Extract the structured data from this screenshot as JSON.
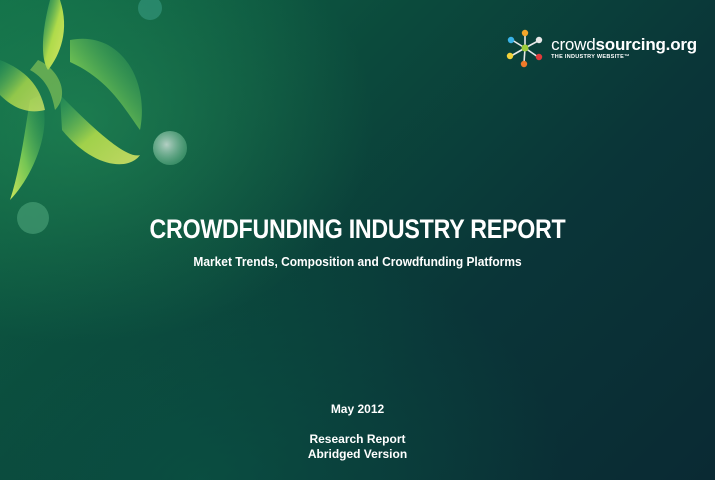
{
  "logo": {
    "name_prefix": "crowd",
    "name_suffix": "sourcing.org",
    "tagline": "THE INDUSTRY WEBSITE™"
  },
  "report": {
    "title": "CROWDFUNDING INDUSTRY REPORT",
    "subtitle": "Market Trends, Composition and Crowdfunding Platforms",
    "date": "May 2012",
    "type_line1": "Research Report",
    "type_line2": "Abridged Version"
  },
  "colors": {
    "background_dark": "#0a2a33",
    "background_green": "#0f6a46",
    "text": "#ffffff",
    "swirl_lime": "#c8e63c",
    "swirl_green": "#3fb36b"
  }
}
